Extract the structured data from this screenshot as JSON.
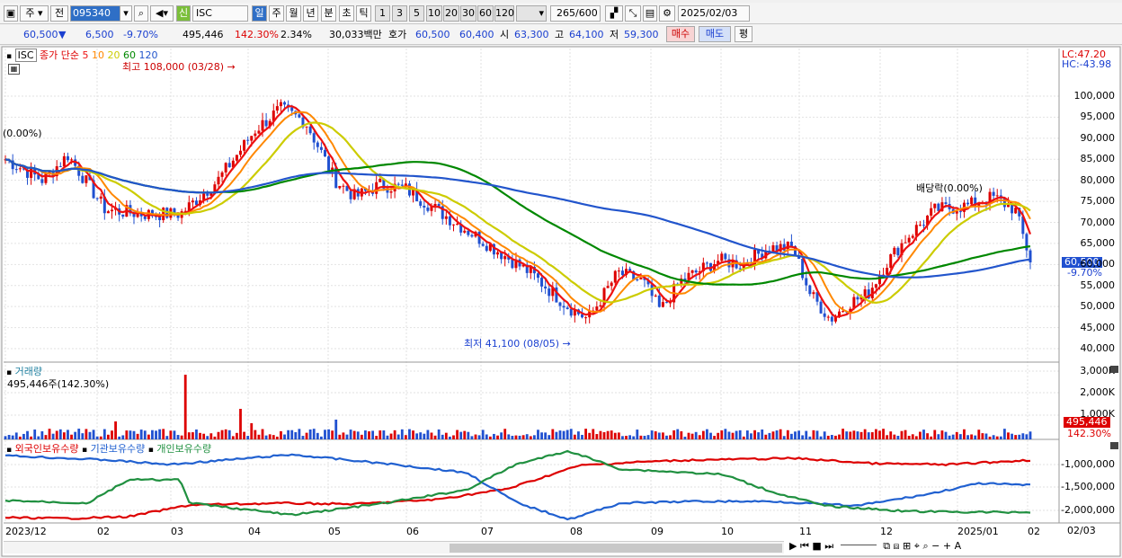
{
  "toolbar": {
    "mode_icon": "window-icon",
    "type": "주",
    "prev": "전",
    "code": "095340",
    "new_badge": "신",
    "name": "ISC",
    "periods": [
      "일",
      "주",
      "월",
      "년",
      "분",
      "초",
      "틱"
    ],
    "active_period": "일",
    "minutes": [
      "1",
      "3",
      "5",
      "10",
      "20",
      "30",
      "60",
      "120"
    ],
    "count": "265",
    "max_count": "/600",
    "date": "2025/02/03"
  },
  "quote": {
    "price": "60,500",
    "arrow": "▼",
    "change": "6,500",
    "rate": "-9.70%",
    "volume": "495,446",
    "vol_rate": "142.30%",
    "turnover": "2.34%",
    "amount": "30,033백만",
    "bid_label": "호가",
    "bid": "60,500",
    "ask": "60,400",
    "open_label": "시",
    "open": "63,300",
    "high_label": "고",
    "high": "64,100",
    "low_label": "저",
    "low": "59,300",
    "buy": "매수",
    "sell": "매도",
    "flat": "평"
  },
  "price_pane": {
    "title": "ISC",
    "ma_label": "종가 단순",
    "ma_periods": [
      "5",
      "10",
      "20",
      "60",
      "120"
    ],
    "ma_colors": [
      "#e11",
      "#f80",
      "#cc0",
      "#080",
      "#2255cc"
    ],
    "high_note": "최고 108,000 (03/28)",
    "low_note": "최저 41,100 (08/05)",
    "start_note": "(0.00%)",
    "div_note": "배당락(0.00%)",
    "lc": "LC:47.20",
    "hc": "HC:-43.98",
    "cur_price": "60,500",
    "cur_rate": "-9.70%",
    "y_ticks": [
      "100,000",
      "95,000",
      "90,000",
      "85,000",
      "80,000",
      "75,000",
      "70,000",
      "65,000",
      "60,000",
      "55,000",
      "50,000",
      "45,000",
      "40,000"
    ]
  },
  "volume_pane": {
    "title": "거래량",
    "summary": "495,446주(142.30%)",
    "y_ticks": [
      "3,000K",
      "2,000K",
      "1,000K"
    ],
    "cur": "495,446",
    "cur_rate": "142.30%"
  },
  "holding_pane": {
    "series": [
      "외국인보유수량",
      "기관보유수량",
      "개인보유수량"
    ],
    "colors": [
      "#d00",
      "#2060d0",
      "#209040"
    ],
    "y_ticks": [
      "-1,000,000",
      "-1,500,000",
      "-2,000,000"
    ]
  },
  "x_axis": {
    "labels": [
      "2023/12",
      "02",
      "03",
      "04",
      "05",
      "06",
      "07",
      "08",
      "09",
      "10",
      "11",
      "12",
      "2025/01",
      "02"
    ],
    "right_label": "02/03"
  }
}
